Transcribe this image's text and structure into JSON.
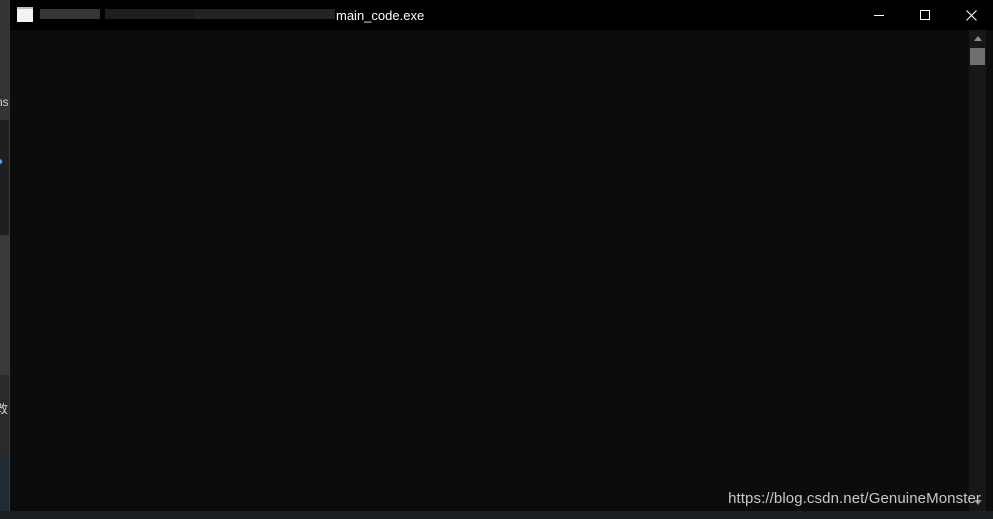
{
  "window": {
    "title": "main_code.exe",
    "title_obscured": true
  },
  "title_controls": {
    "minimize": "minimize-icon",
    "maximize": "maximize-icon",
    "close": "close-icon"
  },
  "background_app": {
    "glyphs": [
      "ns",
      "改"
    ]
  },
  "watermark": {
    "text": "https://blog.csdn.net/GenuineMonster"
  },
  "colors": {
    "console_bg": "#0c0c0c",
    "title_bar_bg": "#000000",
    "title_text": "#ffffff",
    "scroll_thumb": "#6e6e6e"
  }
}
